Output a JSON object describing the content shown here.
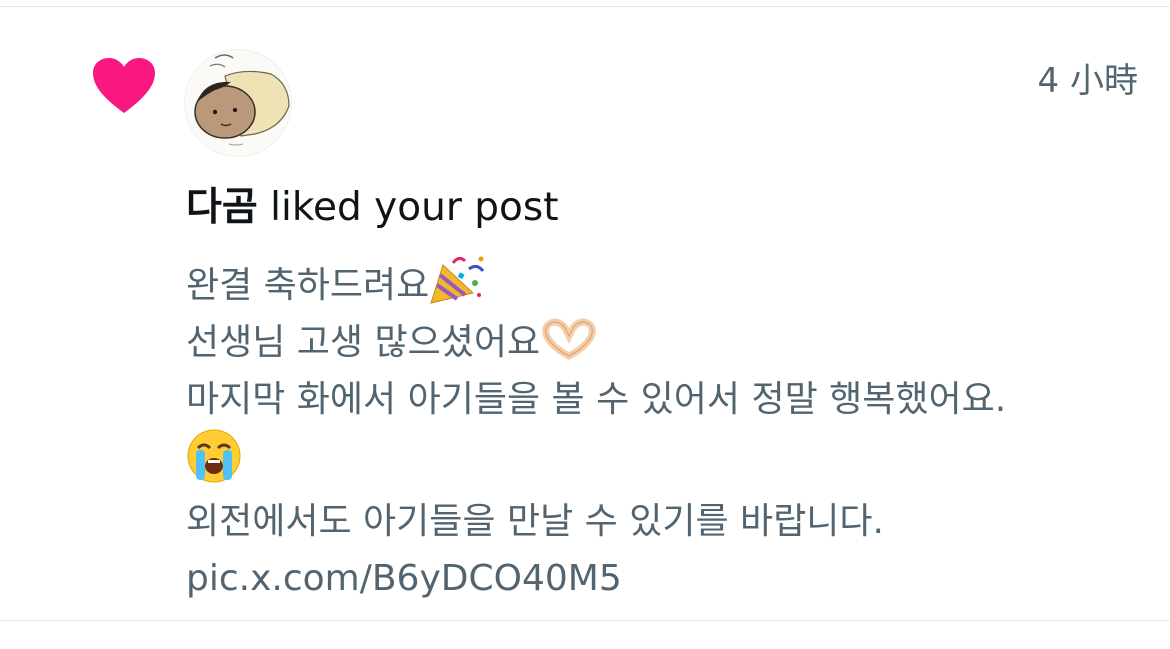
{
  "notification": {
    "type": "like",
    "timestamp": "4 小時",
    "user_name": "다곰",
    "action_text": " liked your post",
    "post": {
      "line1": "완결 축하드려요",
      "line1_emoji": "party-popper-icon",
      "line2": "선생님 고생 많으셨어요",
      "line2_emoji": "heart-hands-icon",
      "line3": "마지막 화에서 아기들을 볼 수 있어서 정말 행복했어요.",
      "line4_emoji": "loudly-crying-face-icon",
      "line5": "외전에서도 아기들을 만날 수 있기를 바랍니다.",
      "link": "pic.x.com/B6yDCO40M5"
    }
  },
  "colors": {
    "heart": "#f91880",
    "text_primary": "#0f1419",
    "text_secondary": "#536471",
    "divider": "#e6e9ec"
  }
}
